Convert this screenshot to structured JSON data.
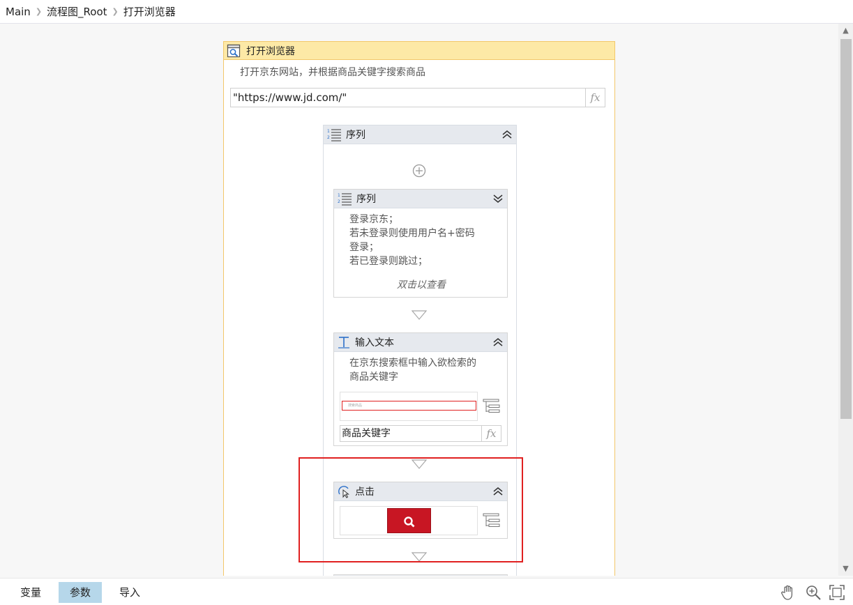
{
  "breadcrumb": {
    "items": [
      "Main",
      "流程图_Root",
      "打开浏览器"
    ]
  },
  "open_browser": {
    "title": "打开浏览器",
    "description": "打开京东网站，并根据商品关键字搜索商品",
    "url_value": "\"https://www.jd.com/\"",
    "fx_label": "fx"
  },
  "sequence": {
    "title": "序列"
  },
  "login_sequence": {
    "title": "序列",
    "description_lines": [
      "登录京东；",
      "若未登录则使用用户名+密码",
      "登录；",
      "若已登录则跳过；"
    ],
    "hint": "双击以查看"
  },
  "input_text": {
    "title": "输入文本",
    "description_lines": [
      "在京东搜索框中输入欲检索的",
      "商品关键字"
    ],
    "value": "商品关键字",
    "fx_label": "fx",
    "preview_text": "搜索商品"
  },
  "click": {
    "title": "点击"
  },
  "bottom_tabs": [
    {
      "label": "变量",
      "active": false
    },
    {
      "label": "参数",
      "active": true
    },
    {
      "label": "导入",
      "active": false
    }
  ],
  "colors": {
    "header_yellow": "#fde9a6",
    "border_yellow": "#f2c86a",
    "highlight_red": "#e02020",
    "jd_red": "#c81623",
    "active_tab": "#b6d7ea"
  }
}
